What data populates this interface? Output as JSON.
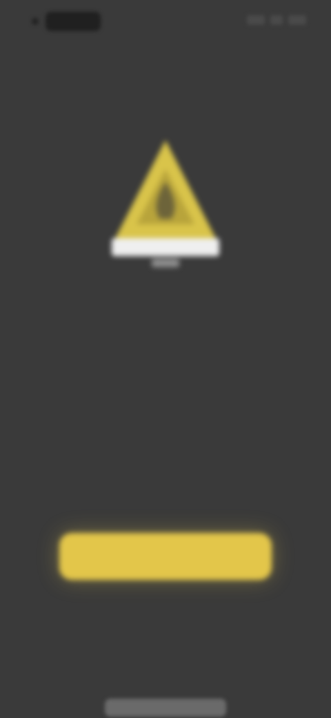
{
  "status_bar": {
    "time": "",
    "icons": [
      "cellular-icon",
      "wifi-icon",
      "battery-icon"
    ]
  },
  "warning": {
    "icon": "warning-triangle-icon",
    "color": "#d9c44a"
  },
  "headline": {
    "line1": "",
    "line2": ""
  },
  "cta": {
    "label": ""
  },
  "footer": {
    "link1": "",
    "link2": ""
  },
  "colors": {
    "background": "#3a3a3a",
    "accent": "#e3c64a",
    "text_light": "#f1f1f1"
  }
}
